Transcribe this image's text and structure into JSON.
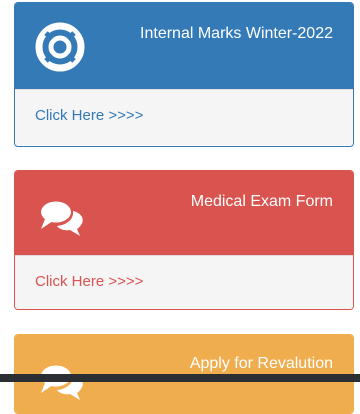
{
  "panels": [
    {
      "title": "Internal Marks Winter-2022",
      "link": "Click Here >>>>",
      "color": "#337ab7",
      "icon": "life-ring-icon"
    },
    {
      "title": "Medical Exam Form",
      "link": "Click Here >>>>",
      "color": "#d9534f",
      "icon": "comments-icon"
    },
    {
      "title": "Apply for Revalution",
      "color": "#f0ad4e",
      "icon": "comments-icon"
    }
  ]
}
